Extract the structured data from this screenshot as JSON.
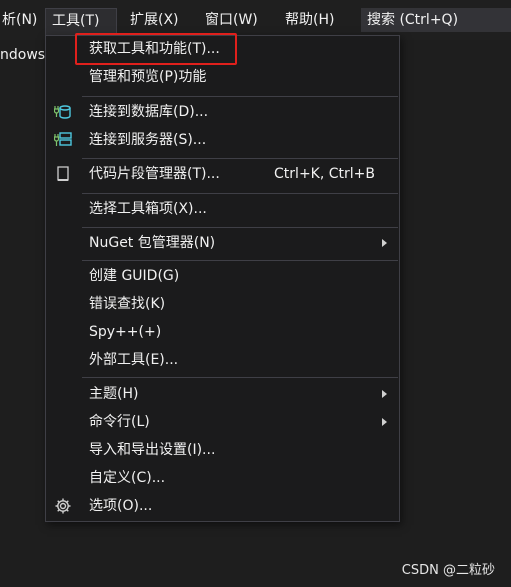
{
  "menubar": {
    "items": [
      {
        "label": "析(N)"
      },
      {
        "label": "工具(T)"
      },
      {
        "label": "扩展(X)"
      },
      {
        "label": "窗口(W)"
      },
      {
        "label": "帮助(H)"
      }
    ],
    "search_label": "搜索 (Ctrl+Q)"
  },
  "background_text": "ndows",
  "menu": {
    "items": [
      {
        "label": "获取工具和功能(T)...",
        "icon": "none"
      },
      {
        "label": "管理和预览(P)功能",
        "icon": "none"
      },
      {
        "label": "连接到数据库(D)...",
        "icon": "database-connect-icon"
      },
      {
        "label": "连接到服务器(S)...",
        "icon": "server-connect-icon"
      },
      {
        "label": "代码片段管理器(T)...",
        "shortcut": "Ctrl+K, Ctrl+B",
        "icon": "snippet-icon"
      },
      {
        "label": "选择工具箱项(X)...",
        "icon": "none"
      },
      {
        "label": "NuGet 包管理器(N)",
        "icon": "none",
        "submenu": true
      },
      {
        "label": "创建 GUID(G)",
        "icon": "none"
      },
      {
        "label": "错误查找(K)",
        "icon": "none"
      },
      {
        "label": "Spy++(+)",
        "icon": "none"
      },
      {
        "label": "外部工具(E)...",
        "icon": "none"
      },
      {
        "label": "主题(H)",
        "icon": "none",
        "submenu": true
      },
      {
        "label": "命令行(L)",
        "icon": "none",
        "submenu": true
      },
      {
        "label": "导入和导出设置(I)...",
        "icon": "none"
      },
      {
        "label": "自定义(C)...",
        "icon": "none"
      },
      {
        "label": "选项(O)...",
        "icon": "gear-icon"
      }
    ]
  },
  "watermark": "CSDN @二粒砂",
  "colors": {
    "menu_bg": "#1b1b1c",
    "highlight_border": "#e0201c",
    "icon_cyan": "#4ec9e0",
    "icon_green": "#7fc46b"
  }
}
